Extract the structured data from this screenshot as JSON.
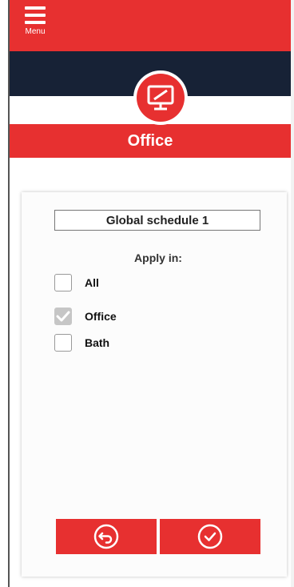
{
  "header": {
    "menu_label": "Menu",
    "device_icon": "monitor-icon",
    "title": "Office"
  },
  "schedule": {
    "name": "Global schedule 1"
  },
  "apply": {
    "label": "Apply in:",
    "options": [
      {
        "label": "All",
        "checked": false
      },
      {
        "label": "Office",
        "checked": true
      },
      {
        "label": "Bath",
        "checked": false
      }
    ]
  },
  "actions": {
    "back_icon": "back-arrow-circle-icon",
    "confirm_icon": "check-circle-icon"
  },
  "colors": {
    "accent": "#e73030",
    "navy": "#172236",
    "checked_box": "#c6c6c6"
  }
}
